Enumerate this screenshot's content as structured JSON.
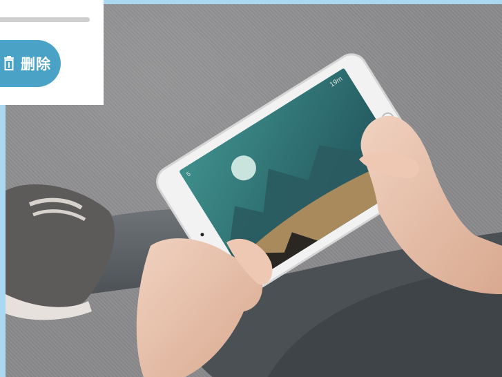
{
  "toolbar": {
    "delete_label": "删除",
    "delete_icon": "trash-icon",
    "accent": "#4aa3c6"
  },
  "game_hud": {
    "coins": "5",
    "distance": "19m"
  }
}
